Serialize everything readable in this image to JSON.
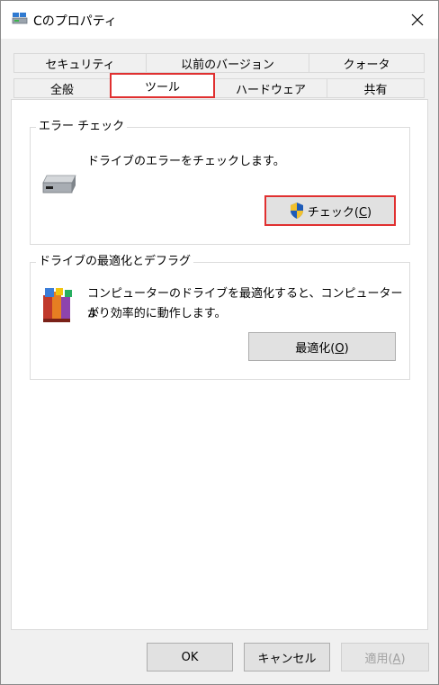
{
  "window": {
    "title": "Cのプロパティ"
  },
  "tabs_row1": [
    {
      "label": "セキュリティ"
    },
    {
      "label": "以前のバージョン"
    },
    {
      "label": "クォータ"
    }
  ],
  "tabs_row2": [
    {
      "label": "全般"
    },
    {
      "label": "ツール"
    },
    {
      "label": "ハードウェア"
    },
    {
      "label": "共有"
    }
  ],
  "error_check": {
    "title": "エラー チェック",
    "description": "ドライブのエラーをチェックします。",
    "button_label": "チェック(",
    "button_key": "C",
    "button_suffix": ")"
  },
  "optimize": {
    "title": "ドライブの最適化とデフラグ",
    "description_line1": "コンピューターのドライブを最適化すると、コンピューターが",
    "description_line2": "より効率的に動作します。",
    "button_label": "最適化(",
    "button_key": "O",
    "button_suffix": ")"
  },
  "footer": {
    "ok_label": "OK",
    "cancel_label": "キャンセル",
    "apply_label": "適用(",
    "apply_key": "A",
    "apply_suffix": ")"
  },
  "colors": {
    "highlight": "#e03030",
    "shield_blue": "#1e5bb8",
    "shield_yellow": "#f2c12e"
  }
}
